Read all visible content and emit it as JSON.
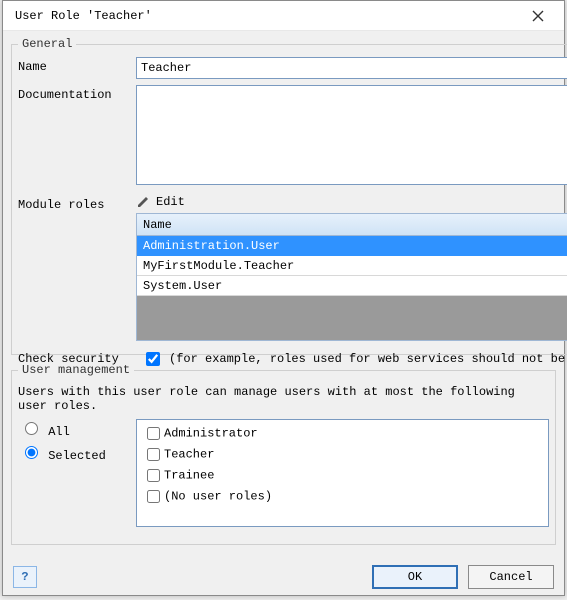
{
  "window": {
    "title": "User Role 'Teacher'"
  },
  "general": {
    "legend": "General",
    "name_label": "Name",
    "name_value": "Teacher",
    "documentation_label": "Documentation",
    "documentation_value": "",
    "module_roles_label": "Module roles",
    "edit_label": "Edit",
    "grid_header": "Name",
    "module_roles": [
      {
        "name": "Administration.User",
        "selected": true
      },
      {
        "name": "MyFirstModule.Teacher",
        "selected": false
      },
      {
        "name": "System.User",
        "selected": false
      }
    ],
    "check_security_label": "Check security",
    "check_security_checked": true,
    "check_security_desc": "(for example, roles used for web services should not be checked for sec"
  },
  "user_management": {
    "legend": "User management",
    "intro": "Users with this user role can manage users with at most the following user roles.",
    "option_all": "All",
    "option_selected": "Selected",
    "choice": "Selected",
    "roles": [
      {
        "label": "Administrator",
        "checked": false
      },
      {
        "label": "Teacher",
        "checked": false
      },
      {
        "label": "Trainee",
        "checked": false
      },
      {
        "label": "(No user roles)",
        "checked": false
      }
    ]
  },
  "footer": {
    "ok": "OK",
    "cancel": "Cancel"
  },
  "icons": {
    "pencil": "pencil-icon",
    "help": "?"
  }
}
